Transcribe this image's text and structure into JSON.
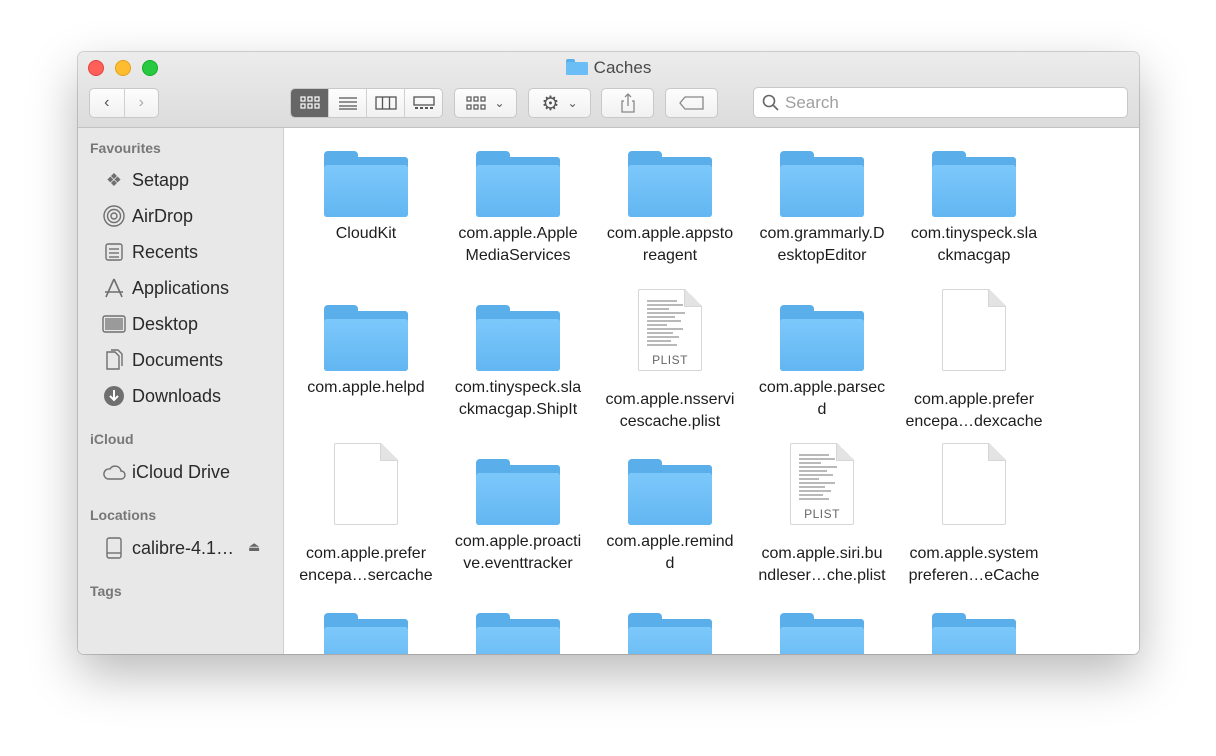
{
  "window": {
    "title": "Caches"
  },
  "toolbar": {
    "back": "‹",
    "forward": "›",
    "search_placeholder": "Search"
  },
  "sidebar": {
    "sections": {
      "favourites": "Favourites",
      "icloud": "iCloud",
      "locations": "Locations",
      "tags": "Tags"
    },
    "favourites": [
      {
        "label": "Setapp",
        "icon": "setapp-icon"
      },
      {
        "label": "AirDrop",
        "icon": "airdrop-icon"
      },
      {
        "label": "Recents",
        "icon": "recents-icon"
      },
      {
        "label": "Applications",
        "icon": "applications-icon"
      },
      {
        "label": "Desktop",
        "icon": "desktop-icon"
      },
      {
        "label": "Documents",
        "icon": "documents-icon"
      },
      {
        "label": "Downloads",
        "icon": "downloads-icon"
      }
    ],
    "icloud": [
      {
        "label": "iCloud Drive",
        "icon": "cloud-icon"
      }
    ],
    "locations": [
      {
        "label": "calibre-4.1…",
        "icon": "disk-icon"
      }
    ]
  },
  "files": [
    {
      "name": "CloudKit",
      "kind": "folder"
    },
    {
      "name": "com.apple.Apple\nMediaServices",
      "kind": "folder"
    },
    {
      "name": "com.apple.appsto\nreagent",
      "kind": "folder"
    },
    {
      "name": "com.grammarly.D\nesktopEditor",
      "kind": "folder"
    },
    {
      "name": "com.tinyspeck.sla\nckmacgap",
      "kind": "folder"
    },
    {
      "name": "com.apple.helpd",
      "kind": "folder"
    },
    {
      "name": "com.tinyspeck.sla\nckmacgap.ShipIt",
      "kind": "folder"
    },
    {
      "name": "com.apple.nsservi\ncescache.plist",
      "kind": "plist",
      "badge": "PLIST"
    },
    {
      "name": "com.apple.parsec\nd",
      "kind": "folder"
    },
    {
      "name": "com.apple.prefer\nencepa…dexcache",
      "kind": "doc"
    },
    {
      "name": "com.apple.prefer\nencepa…sercache",
      "kind": "doc"
    },
    {
      "name": "com.apple.proacti\nve.eventtracker",
      "kind": "folder"
    },
    {
      "name": "com.apple.remind\nd",
      "kind": "folder"
    },
    {
      "name": "com.apple.siri.bu\nndleser…che.plist",
      "kind": "plist",
      "badge": "PLIST"
    },
    {
      "name": "com.apple.system\npreferen…eCache",
      "kind": "doc"
    },
    {
      "name": "",
      "kind": "folder"
    },
    {
      "name": "",
      "kind": "folder"
    },
    {
      "name": "",
      "kind": "folder"
    },
    {
      "name": "",
      "kind": "folder"
    },
    {
      "name": "",
      "kind": "folder"
    }
  ]
}
